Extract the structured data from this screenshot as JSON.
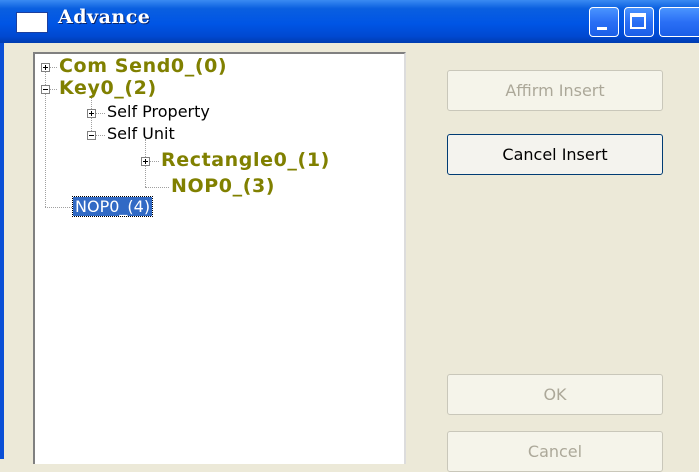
{
  "window": {
    "title": "Advance"
  },
  "tree": {
    "nodes": [
      {
        "label": "Com Send0_(0)",
        "expander": "plus"
      },
      {
        "label": "Key0_(2)",
        "expander": "minus"
      },
      {
        "label": "Self Property",
        "expander": "plus"
      },
      {
        "label": "Self Unit",
        "expander": "minus"
      },
      {
        "label": "Rectangle0_(1)",
        "expander": "plus"
      },
      {
        "label": "NOP0_(3)",
        "expander": "none"
      },
      {
        "label": "NOP0_(4)",
        "expander": "none",
        "selected": true
      }
    ]
  },
  "buttons": {
    "affirm_insert": {
      "label": "Affirm Insert",
      "enabled": false
    },
    "cancel_insert": {
      "label": "Cancel Insert",
      "enabled": true
    },
    "ok": {
      "label": "OK",
      "enabled": false
    },
    "cancel": {
      "label": "Cancel",
      "enabled": false
    }
  },
  "colors": {
    "titlebar": "#0055e5",
    "selection": "#316ac5",
    "bold_node_text": "#808000",
    "dialog_bg": "#ece9d8"
  }
}
